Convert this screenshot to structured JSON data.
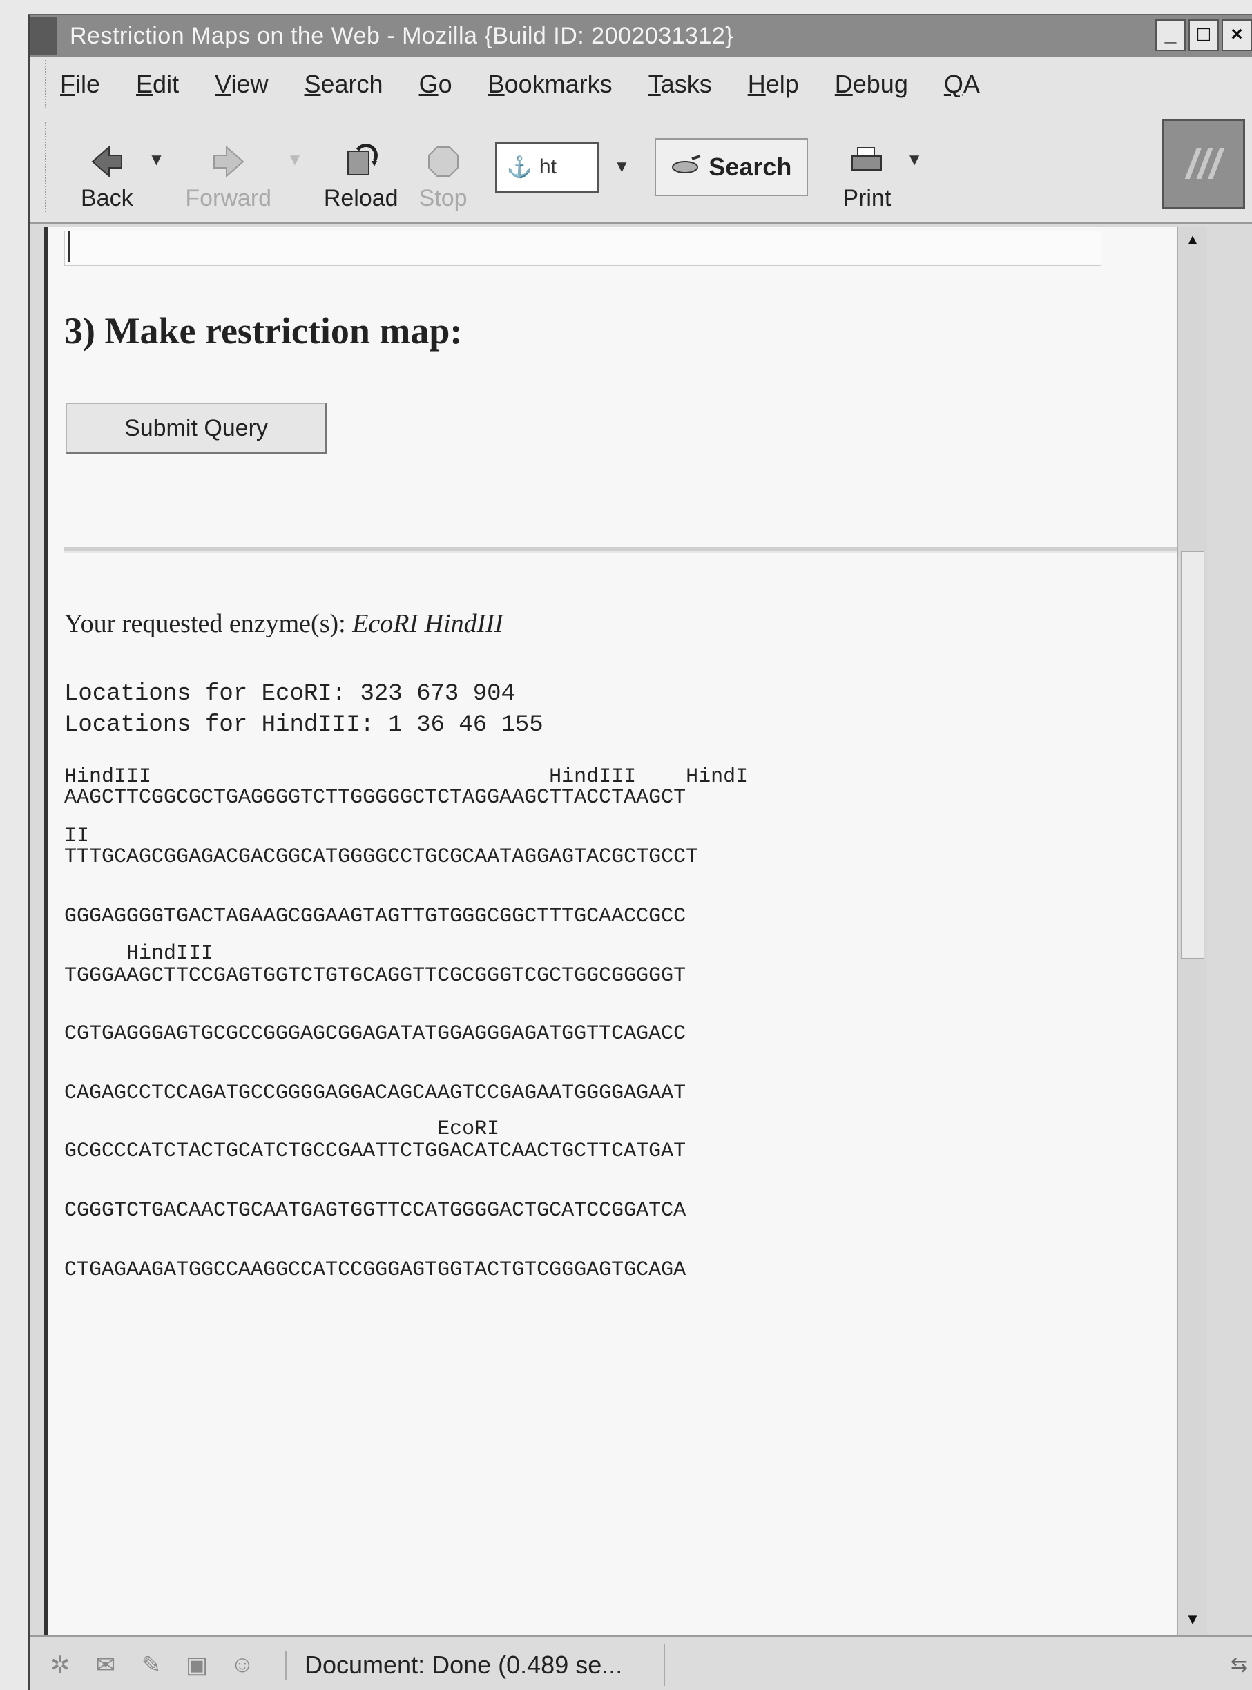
{
  "window": {
    "title": "Restriction Maps on the Web - Mozilla {Build ID: 2002031312}",
    "minimize": "_",
    "maximize": "□",
    "close": "×"
  },
  "menubar": {
    "items": [
      {
        "label": "File",
        "key": "F"
      },
      {
        "label": "Edit",
        "key": "E"
      },
      {
        "label": "View",
        "key": "V"
      },
      {
        "label": "Search",
        "key": "S"
      },
      {
        "label": "Go",
        "key": "G"
      },
      {
        "label": "Bookmarks",
        "key": "B"
      },
      {
        "label": "Tasks",
        "key": "T"
      },
      {
        "label": "Help",
        "key": "H"
      },
      {
        "label": "Debug",
        "key": "D"
      },
      {
        "label": "QA",
        "key": "Q"
      }
    ]
  },
  "toolbar": {
    "back": "Back",
    "forward": "Forward",
    "reload": "Reload",
    "stop": "Stop",
    "url_value": "ht",
    "search": "Search",
    "print": "Print"
  },
  "page": {
    "section_heading": "3) Make restriction map:",
    "submit_label": "Submit Query",
    "requested_prefix": "Your requested enzyme(s): ",
    "requested_enzymes": "EcoRI HindIII",
    "locations_ecori": "Locations for EcoRI: 323 673 904",
    "locations_hindiii": "Locations for HindIII: 1 36 46 155",
    "sequence_lines": [
      {
        "label": "HindIII                                HindIII    HindI",
        "seq": "AAGCTTCGGCGCTGAGGGGTCTTGGGGGCTCTAGGAAGCTTACCTAAGCT"
      },
      {
        "label": "II",
        "seq": "TTTGCAGCGGAGACGACGGCATGGGGCCTGCGCAATAGGAGTACGCTGCCT"
      },
      {
        "label": "",
        "seq": "GGGAGGGGTGACTAGAAGCGGAAGTAGTTGTGGGCGGCTTTGCAACCGCC"
      },
      {
        "label": "     HindIII",
        "seq": "TGGGAAGCTTCCGAGTGGTCTGTGCAGGTTCGCGGGTCGCTGGCGGGGGT"
      },
      {
        "label": "",
        "seq": "CGTGAGGGAGTGCGCCGGGAGCGGAGATATGGAGGGAGATGGTTCAGACC"
      },
      {
        "label": "",
        "seq": "CAGAGCCTCCAGATGCCGGGGAGGACAGCAAGTCCGAGAATGGGGAGAAT"
      },
      {
        "label": "                              EcoRI",
        "seq": "GCGCCCATCTACTGCATCTGCCGAATTCTGGACATCAACTGCTTCATGAT"
      },
      {
        "label": "",
        "seq": "CGGGTCTGACAACTGCAATGAGTGGTTCCATGGGGACTGCATCCGGATCA"
      },
      {
        "label": "",
        "seq": "CTGAGAAGATGGCCAAGGCCATCCGGGAGTGGTACTGTCGGGAGTGCAGA"
      }
    ]
  },
  "status": {
    "text": "Document: Done (0.489 se..."
  }
}
